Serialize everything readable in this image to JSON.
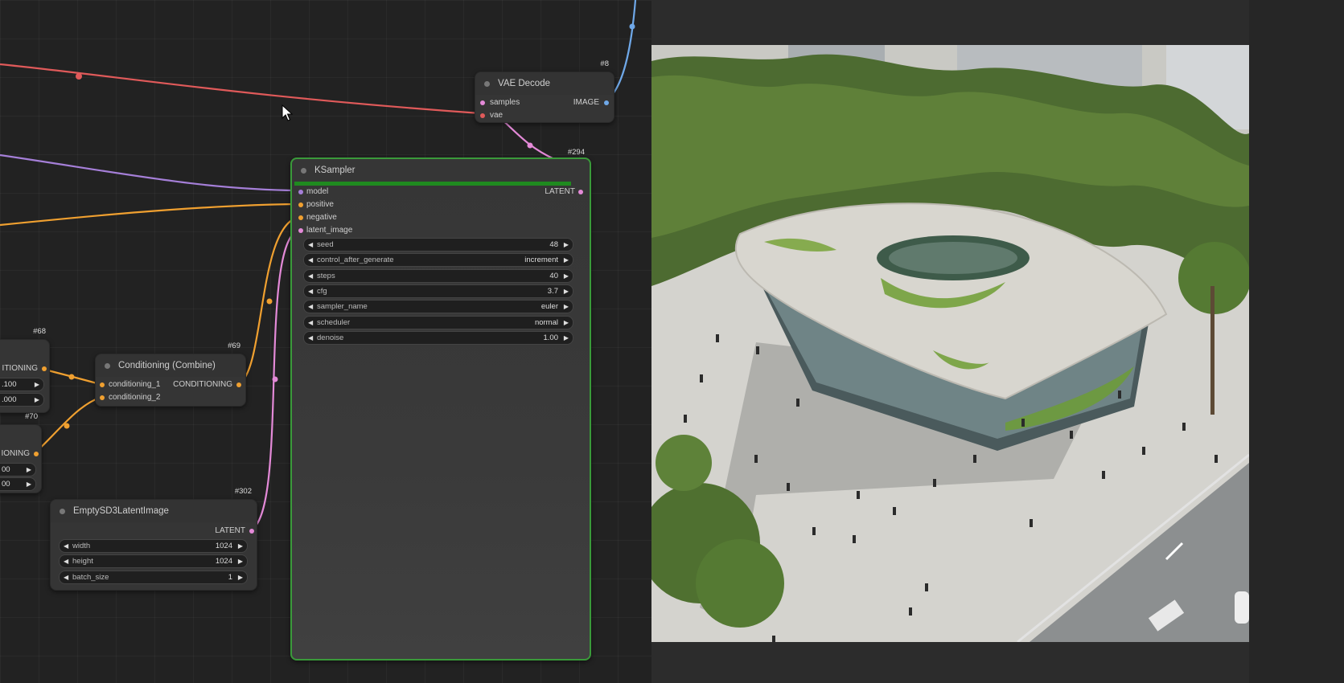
{
  "nodes": {
    "vae_decode": {
      "id": "#8",
      "title": "VAE Decode",
      "inputs": [
        "samples",
        "vae"
      ],
      "output": "IMAGE"
    },
    "ksampler": {
      "id": "#294",
      "title": "KSampler",
      "inputs": [
        "model",
        "positive",
        "negative",
        "latent_image"
      ],
      "output": "LATENT",
      "progress": 1.0,
      "widgets": [
        {
          "label": "seed",
          "value": "48"
        },
        {
          "label": "control_after_generate",
          "value": "increment"
        },
        {
          "label": "steps",
          "value": "40"
        },
        {
          "label": "cfg",
          "value": "3.7"
        },
        {
          "label": "sampler_name",
          "value": "euler"
        },
        {
          "label": "scheduler",
          "value": "normal"
        },
        {
          "label": "denoise",
          "value": "1.00"
        }
      ]
    },
    "conditioning_combine": {
      "id": "#69",
      "title": "Conditioning (Combine)",
      "inputs": [
        "conditioning_1",
        "conditioning_2"
      ],
      "output": "CONDITIONING"
    },
    "node_68": {
      "id": "#68",
      "output": "ITIONING",
      "widget_values": [
        ".100",
        ".000"
      ]
    },
    "node_70": {
      "id": "#70",
      "output": "IONING",
      "widget_values": [
        "00",
        "00"
      ]
    },
    "empty_latent": {
      "id": "#302",
      "title": "EmptySD3LatentImage",
      "output": "LATENT",
      "widgets": [
        {
          "label": "width",
          "value": "1024"
        },
        {
          "label": "height",
          "value": "1024"
        },
        {
          "label": "batch_size",
          "value": "1"
        }
      ]
    }
  },
  "colors": {
    "vae_wire": "#e05a5a",
    "model_wire": "#a57fd8",
    "conditioning_wire": "#f0a030",
    "latent_wire": "#e48ad8",
    "image_wire": "#6fa8e8",
    "selected_border": "#3a9a3a",
    "progress_bar": "#1f8a1f"
  },
  "icons": {
    "cursor": "mouse-pointer-icon",
    "decrement": "arrow-left-icon",
    "increment": "arrow-right-icon"
  }
}
